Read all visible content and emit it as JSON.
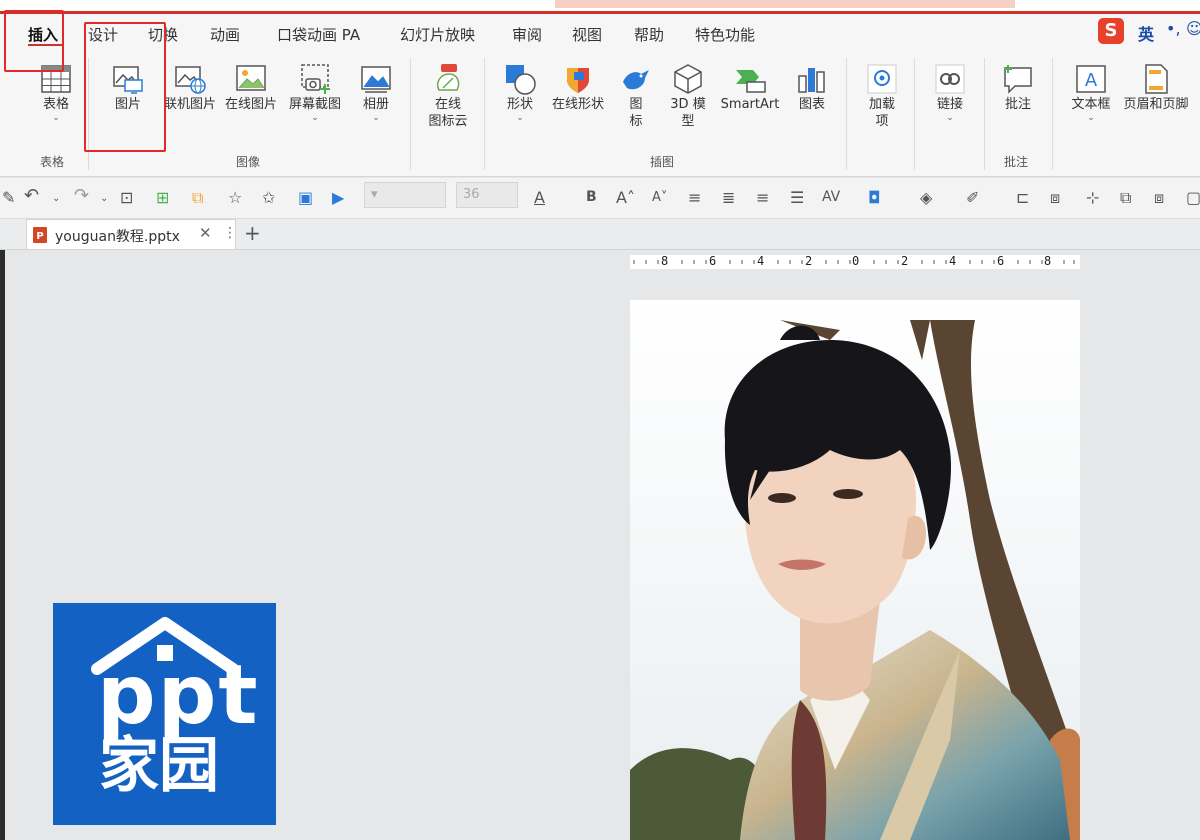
{
  "menu": {
    "tabs": [
      "插入",
      "设计",
      "切换",
      "动画",
      "口袋动画 PA",
      "幻灯片放映",
      "审阅",
      "视图",
      "帮助",
      "特色功能"
    ],
    "active_tab": "插入"
  },
  "ime": {
    "label": "英"
  },
  "ribbon": {
    "buttons": {
      "table": "表格",
      "picture": "图片",
      "online_pic_machine": "联机图片",
      "online_pic": "在线图片",
      "screenshot": "屏幕截图",
      "album": "相册",
      "online_icon_l1": "在线",
      "online_icon_l2": "图标云",
      "shape": "形状",
      "online_shape": "在线形状",
      "icon_l1": "图",
      "icon_l2": "标",
      "model3d_l1": "3D 模",
      "model3d_l2": "型",
      "smartart": "SmartArt",
      "chart": "图表",
      "addin_l1": "加载",
      "addin_l2": "项",
      "link": "链接",
      "comment": "批注",
      "textbox": "文本框",
      "header_footer": "页眉和页脚"
    },
    "groups": {
      "table": "表格",
      "image": "图像",
      "illustration": "插图",
      "comment": "批注"
    }
  },
  "toolbar": {
    "font_size": "36"
  },
  "document": {
    "tab_name": "youguan教程.pptx"
  },
  "ruler": {
    "labels": [
      "8",
      "6",
      "4",
      "2",
      "0",
      "2",
      "4",
      "6",
      "8"
    ]
  },
  "logo": {
    "line1": "ppt",
    "line2": "家园"
  },
  "colors": {
    "accent": "#c9332c",
    "highlight": "#e02a2a",
    "logo_bg": "#1461c4"
  }
}
